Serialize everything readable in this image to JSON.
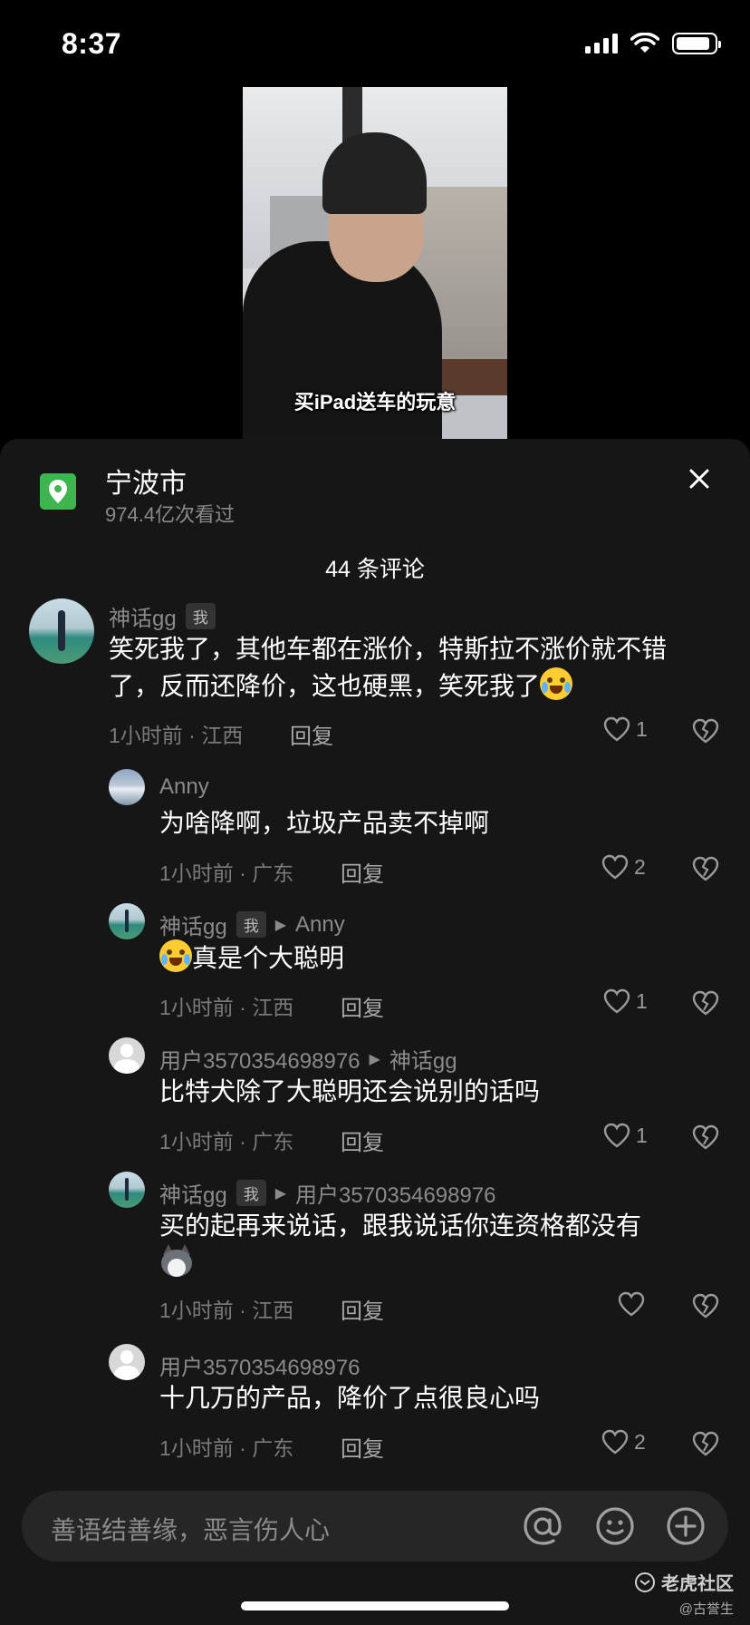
{
  "status_bar": {
    "time": "8:37",
    "battery_level": 0.9
  },
  "video": {
    "caption": "买iPad送车的玩意"
  },
  "location": {
    "title": "宁波市",
    "views": "974.4亿次看过"
  },
  "comments_header": {
    "count_label": "44 条评论"
  },
  "comments": [
    {
      "name": "神话gg",
      "badge": "我",
      "reply_to": "",
      "text": "笑死我了，其他车都在涨价，特斯拉不涨价就不错了，反而还降价，这也硬黑，笑死我了",
      "emoji": "crying-laughing-emoji",
      "meta": "1小时前 · 江西",
      "reply": "回复",
      "likes": "1"
    },
    {
      "name": "Anny",
      "badge": "",
      "reply_to": "",
      "text": "为啥降啊，垃圾产品卖不掉啊",
      "meta": "1小时前 · 广东",
      "reply": "回复",
      "likes": "2"
    },
    {
      "name": "神话gg",
      "badge": "我",
      "reply_to": "Anny",
      "text": "真是个大聪明",
      "emoji": "crying-laughing-emoji",
      "meta": "1小时前 · 江西",
      "reply": "回复",
      "likes": "1"
    },
    {
      "name": "用户3570354698976",
      "badge": "",
      "reply_to": "神话gg",
      "text": "比特犬除了大聪明还会说别的话吗",
      "meta": "1小时前 · 广东",
      "reply": "回复",
      "likes": "1"
    },
    {
      "name": "神话gg",
      "badge": "我",
      "reply_to": "用户3570354698976",
      "text": "买的起再来说话，跟我说话你连资格都没有",
      "emoji": "husky-emoji",
      "meta": "1小时前 · 江西",
      "reply": "回复",
      "likes": ""
    },
    {
      "name": "用户3570354698976",
      "badge": "",
      "reply_to": "",
      "text": "十几万的产品，降价了点很良心吗",
      "meta": "1小时前 · 广东",
      "reply": "回复",
      "likes": "2"
    }
  ],
  "input": {
    "placeholder": "善语结善缘，恶言伤人心"
  },
  "watermark": {
    "main": "老虎社区",
    "sub": "@古誉生"
  }
}
